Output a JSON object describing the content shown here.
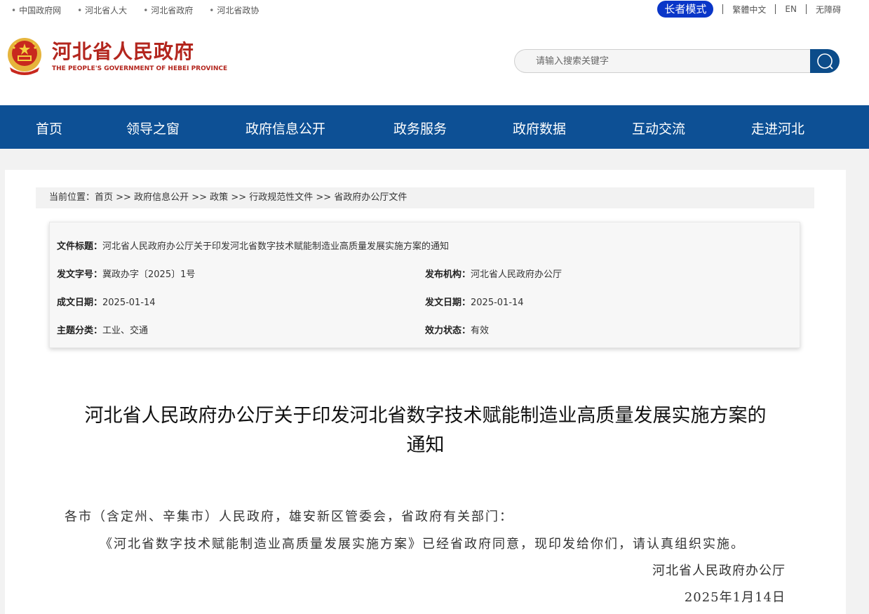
{
  "top_links": [
    "中国政府网",
    "河北省人大",
    "河北省政府",
    "河北省政协"
  ],
  "top_right": {
    "elder_mode": "长者模式",
    "traditional": "繁體中文",
    "english": "EN",
    "accessibility": "无障碍"
  },
  "logo": {
    "cn": "河北省人民政府",
    "en": "THE PEOPLE'S GOVERNMENT OF HEBEI PROVINCE"
  },
  "search": {
    "placeholder": "请输入搜索关键字"
  },
  "nav": [
    "首页",
    "领导之窗",
    "政府信息公开",
    "政务服务",
    "政府数据",
    "互动交流",
    "走进河北"
  ],
  "breadcrumb": {
    "prefix": "当前位置：",
    "items": [
      "首页",
      "政府信息公开",
      "政策",
      "行政规范性文件",
      "省政府办公厅文件"
    ],
    "sep": " >> "
  },
  "meta": {
    "title_label": "文件标题：",
    "title_value": "河北省人民政府办公厅关于印发河北省数字技术赋能制造业高质量发展实施方案的通知",
    "doc_no_label": "发文字号：",
    "doc_no_value": "冀政办字〔2025〕1号",
    "issuer_label": "发布机构：",
    "issuer_value": "河北省人民政府办公厅",
    "written_label": "成文日期：",
    "written_value": "2025-01-14",
    "issued_label": "发文日期：",
    "issued_value": "2025-01-14",
    "topic_label": "主题分类：",
    "topic_value": "工业、交通",
    "status_label": "效力状态：",
    "status_value": "有效"
  },
  "document": {
    "title_line1": "河北省人民政府办公厅关于印发河北省数字技术赋能制造业高质量发展实施方案的",
    "title_line2": "通知",
    "salutation": "各市（含定州、辛集市）人民政府，雄安新区管委会，省政府有关部门：",
    "body": "《河北省数字技术赋能制造业高质量发展实施方案》已经省政府同意，现印发给你们，请认真组织实施。",
    "signature": "河北省人民政府办公厅",
    "date": "2025年1月14日"
  },
  "colors": {
    "nav_bg": "#0d5095",
    "logo_red": "#b3261e",
    "elder_btn": "#0a36c8"
  }
}
